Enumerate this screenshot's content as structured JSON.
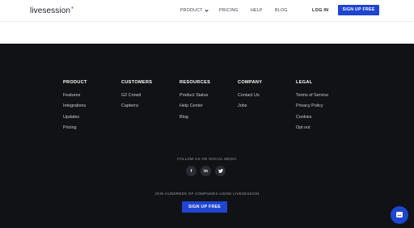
{
  "header": {
    "logo": "livesession",
    "logo_mark": "®",
    "nav": {
      "product": "PRODUCT",
      "pricing": "PRICING",
      "help": "HELP",
      "blog": "BLOG"
    },
    "login": "LOG IN",
    "signup": "SIGN UP FREE"
  },
  "footer": {
    "columns": [
      {
        "title": "PRODUCT",
        "links": [
          "Features",
          "Integrations",
          "Updates",
          "Pricing"
        ]
      },
      {
        "title": "CUSTOMERS",
        "links": [
          "G2 Crowd",
          "Capterra"
        ]
      },
      {
        "title": "RESOURCES",
        "links": [
          "Product Status",
          "Help Center",
          "Blog"
        ]
      },
      {
        "title": "COMPANY",
        "links": [
          "Contact Us",
          "Jobs"
        ]
      },
      {
        "title": "LEGAL",
        "links": [
          "Terms of Service",
          "Privacy Policy",
          "Cookies",
          "Opt out"
        ]
      }
    ],
    "follow_label": "FOLLOW US ON SOCIAL MEDIA",
    "socials": [
      "f",
      "in",
      "t"
    ],
    "join_label": "JOIN HUNDREDS OF COMPANIES USING LIVESESSION",
    "signup": "SIGN UP FREE"
  },
  "icons": {
    "facebook": "facebook-icon",
    "linkedin": "linkedin-icon",
    "twitter": "twitter-icon",
    "chat": "chat-icon"
  },
  "colors": {
    "accent": "#1f45d1",
    "footer_bg": "#111216",
    "header_bg": "#ffffff"
  }
}
